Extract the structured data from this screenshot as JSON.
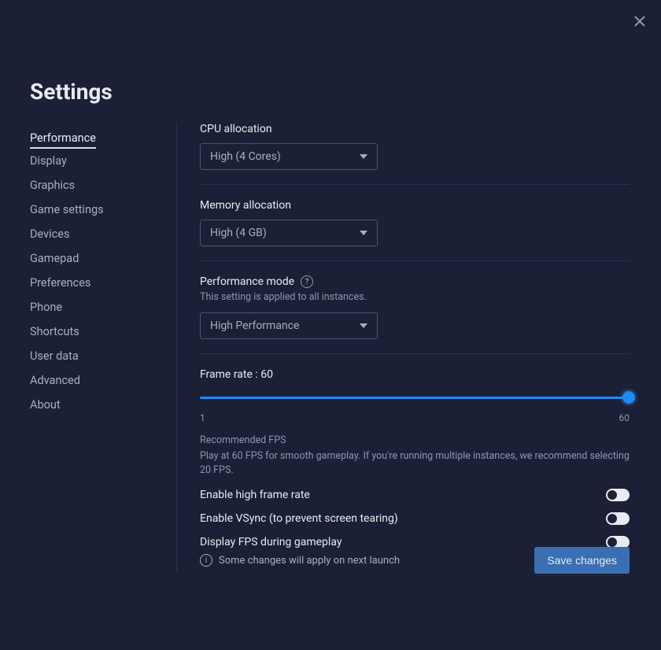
{
  "title": "Settings",
  "sidebar": {
    "items": [
      {
        "label": "Performance",
        "active": true
      },
      {
        "label": "Display"
      },
      {
        "label": "Graphics"
      },
      {
        "label": "Game settings"
      },
      {
        "label": "Devices"
      },
      {
        "label": "Gamepad"
      },
      {
        "label": "Preferences"
      },
      {
        "label": "Phone"
      },
      {
        "label": "Shortcuts"
      },
      {
        "label": "User data"
      },
      {
        "label": "Advanced"
      },
      {
        "label": "About"
      }
    ]
  },
  "cpu": {
    "label": "CPU allocation",
    "value": "High (4 Cores)"
  },
  "memory": {
    "label": "Memory allocation",
    "value": "High (4 GB)"
  },
  "perf_mode": {
    "label": "Performance mode",
    "hint": "This setting is applied to all instances.",
    "value": "High Performance"
  },
  "frame_rate": {
    "label": "Frame rate : 60",
    "min": "1",
    "max": "60",
    "value": 60,
    "rec_title": "Recommended FPS",
    "rec_text": "Play at 60 FPS for smooth gameplay. If you're running multiple instances, we recommend selecting 20 FPS."
  },
  "toggles": {
    "high_fps": {
      "label": "Enable high frame rate",
      "on": false
    },
    "vsync": {
      "label": "Enable VSync (to prevent screen tearing)",
      "on": false
    },
    "show_fps": {
      "label": "Display FPS during gameplay",
      "on": false
    }
  },
  "footer": {
    "warning": "Some changes will apply on next launch",
    "save": "Save changes"
  }
}
